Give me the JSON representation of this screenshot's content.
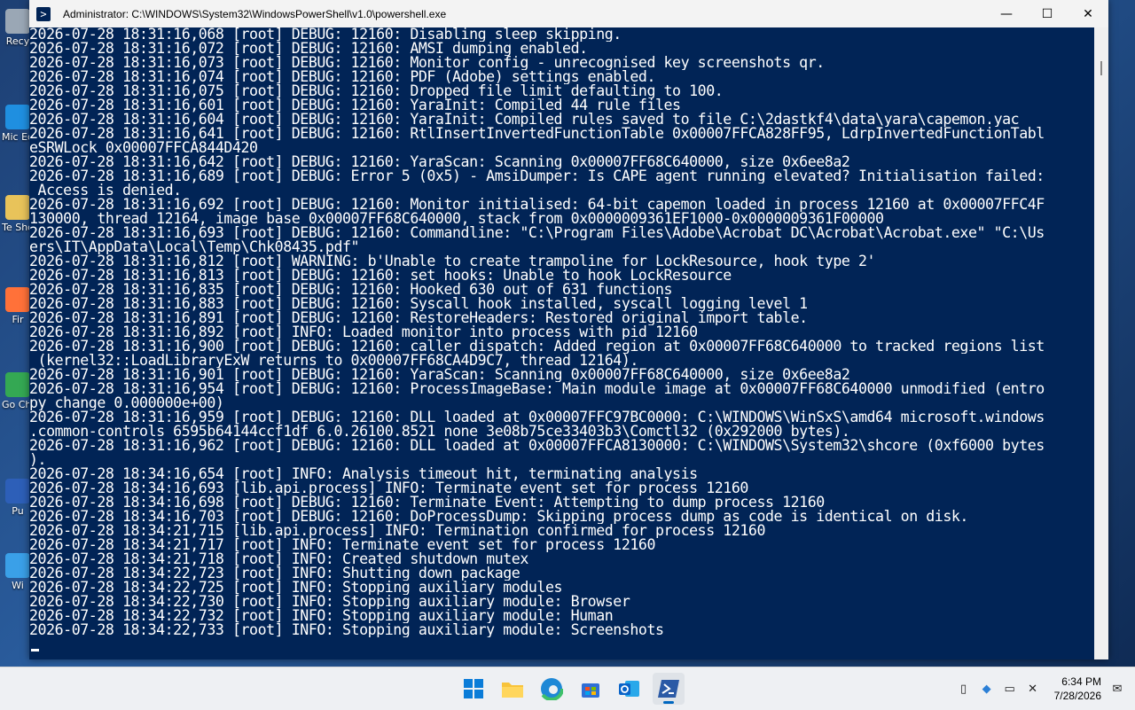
{
  "window": {
    "title": "Administrator: C:\\WINDOWS\\System32\\WindowsPowerShell\\v1.0\\powershell.exe",
    "minimize": "—",
    "maximize": "☐",
    "close": "✕"
  },
  "desktop_icons": [
    {
      "label": "Recy",
      "color": "#9aa7b5"
    },
    {
      "label": "Mic Ed",
      "color": "#1f8fe0"
    },
    {
      "label": "Te Sho",
      "color": "#e8c35a"
    },
    {
      "label": "Fir",
      "color": "#ff7139"
    },
    {
      "label": "Go Chr",
      "color": "#34a853"
    },
    {
      "label": "Pu",
      "color": "#2d5fb8"
    },
    {
      "label": "Wi",
      "color": "#3aa0e8"
    }
  ],
  "console_lines": [
    "2026-07-28 18:31:16,068 [root] DEBUG: 12160: Disabling sleep skipping.",
    "2026-07-28 18:31:16,072 [root] DEBUG: 12160: AMSI dumping enabled.",
    "2026-07-28 18:31:16,073 [root] DEBUG: 12160: Monitor config - unrecognised key screenshots_qr.",
    "2026-07-28 18:31:16,074 [root] DEBUG: 12160: PDF (Adobe) settings enabled.",
    "2026-07-28 18:31:16,075 [root] DEBUG: 12160: Dropped file limit defaulting to 100.",
    "2026-07-28 18:31:16,601 [root] DEBUG: 12160: YaraInit: Compiled 44 rule files",
    "2026-07-28 18:31:16,604 [root] DEBUG: 12160: YaraInit: Compiled rules saved to file C:\\2dastkf4\\data\\yara\\capemon.yac",
    "2026-07-28 18:31:16,641 [root] DEBUG: 12160: RtlInsertInvertedFunctionTable 0x00007FFCA828FF95, LdrpInvertedFunctionTabl",
    "eSRWLock 0x00007FFCA844D420",
    "2026-07-28 18:31:16,642 [root] DEBUG: 12160: YaraScan: Scanning 0x00007FF68C640000, size 0x6ee8a2",
    "2026-07-28 18:31:16,689 [root] DEBUG: Error 5 (0x5) - AmsiDumper: Is CAPE agent running elevated? Initialisation failed:",
    " Access is denied.",
    "2026-07-28 18:31:16,692 [root] DEBUG: 12160: Monitor initialised: 64-bit capemon loaded in process 12160 at 0x00007FFC4F",
    "130000, thread 12164, image base 0x00007FF68C640000, stack from 0x0000009361EF1000-0x0000009361F00000",
    "2026-07-28 18:31:16,693 [root] DEBUG: 12160: Commandline: \"C:\\Program Files\\Adobe\\Acrobat DC\\Acrobat\\Acrobat.exe\" \"C:\\Us",
    "ers\\IT\\AppData\\Local\\Temp\\Chk08435.pdf\"",
    "2026-07-28 18:31:16,812 [root] WARNING: b'Unable to create trampoline for LockResource, hook type 2'",
    "2026-07-28 18:31:16,813 [root] DEBUG: 12160: set_hooks: Unable to hook LockResource",
    "2026-07-28 18:31:16,835 [root] DEBUG: 12160: Hooked 630 out of 631 functions",
    "2026-07-28 18:31:16,883 [root] DEBUG: 12160: Syscall hook installed, syscall logging level 1",
    "2026-07-28 18:31:16,891 [root] DEBUG: 12160: RestoreHeaders: Restored original import table.",
    "2026-07-28 18:31:16,892 [root] INFO: Loaded monitor into process with pid 12160",
    "2026-07-28 18:31:16,900 [root] DEBUG: 12160: caller_dispatch: Added region at 0x00007FF68C640000 to tracked regions list",
    " (kernel32::LoadLibraryExW returns to 0x00007FF68CA4D9C7, thread 12164).",
    "2026-07-28 18:31:16,901 [root] DEBUG: 12160: YaraScan: Scanning 0x00007FF68C640000, size 0x6ee8a2",
    "2026-07-28 18:31:16,954 [root] DEBUG: 12160: ProcessImageBase: Main module image at 0x00007FF68C640000 unmodified (entro",
    "py change 0.000000e+00)",
    "2026-07-28 18:31:16,959 [root] DEBUG: 12160: DLL loaded at 0x00007FFC97BC0000: C:\\WINDOWS\\WinSxS\\amd64_microsoft.windows",
    ".common-controls_6595b64144ccf1df_6.0.26100.8521_none_3e08b75ce33403b3\\Comctl32 (0x292000 bytes).",
    "2026-07-28 18:31:16,962 [root] DEBUG: 12160: DLL loaded at 0x00007FFCA8130000: C:\\WINDOWS\\System32\\shcore (0xf6000 bytes",
    ").",
    "2026-07-28 18:34:16,654 [root] INFO: Analysis timeout hit, terminating analysis",
    "2026-07-28 18:34:16,693 [lib.api.process] INFO: Terminate event set for process 12160",
    "2026-07-28 18:34:16,698 [root] DEBUG: 12160: Terminate Event: Attempting to dump process 12160",
    "2026-07-28 18:34:16,703 [root] DEBUG: 12160: DoProcessDump: Skipping process dump as code is identical on disk.",
    "2026-07-28 18:34:21,715 [lib.api.process] INFO: Termination confirmed for process 12160",
    "2026-07-28 18:34:21,717 [root] INFO: Terminate event set for process 12160",
    "2026-07-28 18:34:21,718 [root] INFO: Created shutdown mutex",
    "2026-07-28 18:34:22,723 [root] INFO: Shutting down package",
    "2026-07-28 18:34:22,725 [root] INFO: Stopping auxiliary modules",
    "2026-07-28 18:34:22,730 [root] INFO: Stopping auxiliary module: Browser",
    "2026-07-28 18:34:22,732 [root] INFO: Stopping auxiliary module: Human",
    "2026-07-28 18:34:22,733 [root] INFO: Stopping auxiliary module: Screenshots"
  ],
  "taskbar": {
    "apps": [
      {
        "name": "start-button",
        "icon": "windows-logo"
      },
      {
        "name": "taskbar-file-explorer",
        "icon": "folder"
      },
      {
        "name": "taskbar-edge",
        "icon": "edge"
      },
      {
        "name": "taskbar-store",
        "icon": "store"
      },
      {
        "name": "taskbar-outlook",
        "icon": "outlook"
      },
      {
        "name": "taskbar-powershell",
        "icon": "powershell",
        "active": true
      }
    ],
    "time": "6:34 PM",
    "date": "7/28/2026"
  },
  "colors": {
    "console_bg": "#012456",
    "console_fg": "#ffffff",
    "accent": "#0067c0"
  }
}
